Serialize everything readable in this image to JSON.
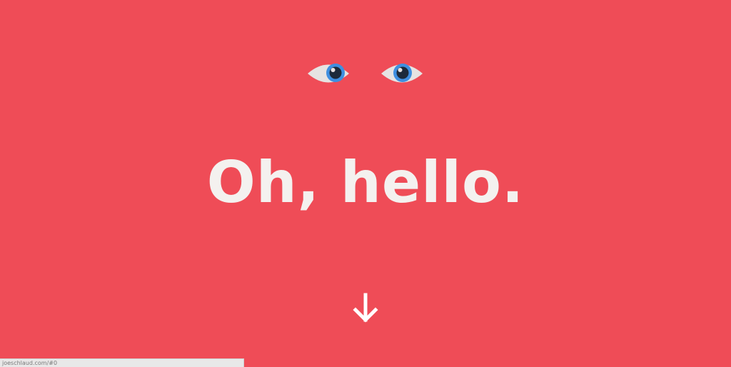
{
  "page": {
    "background_color": "#ef4c57"
  },
  "hero": {
    "heading": "Oh, hello.",
    "heading_color": "#f4f1ef"
  },
  "eyes": {
    "left_icon": "eye-icon",
    "right_icon": "eye-icon",
    "sclera_color": "#e6e3e2",
    "iris_color": "#3f8fe0",
    "pupil_color": "#1d2a3a"
  },
  "scroll": {
    "icon": "arrow-down-icon",
    "color": "#ffffff"
  },
  "status_bar": {
    "url": "joeschlaud.com/#0"
  }
}
